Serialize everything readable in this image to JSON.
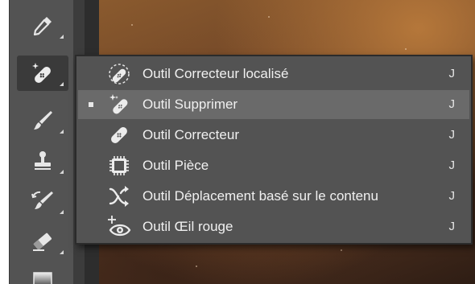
{
  "app": "Photoshop",
  "toolbar": {
    "tools": [
      {
        "name": "eyedropper-tool",
        "icon": "eyedropper-icon"
      },
      {
        "name": "spot-healing-tool",
        "icon": "healing-bandage-sparkle-icon",
        "active": true
      },
      {
        "name": "brush-tool",
        "icon": "brush-icon"
      },
      {
        "name": "clone-stamp-tool",
        "icon": "stamp-icon"
      },
      {
        "name": "history-brush-tool",
        "icon": "history-brush-icon"
      },
      {
        "name": "eraser-tool",
        "icon": "eraser-icon"
      },
      {
        "name": "gradient-tool",
        "icon": "gradient-icon"
      }
    ]
  },
  "flyout": {
    "items": [
      {
        "label": "Outil Correcteur localisé",
        "shortcut": "J",
        "icon": "spot-healing-brush-icon",
        "selected": false
      },
      {
        "label": "Outil Supprimer",
        "shortcut": "J",
        "icon": "remove-tool-icon",
        "selected": true
      },
      {
        "label": "Outil Correcteur",
        "shortcut": "J",
        "icon": "healing-brush-icon",
        "selected": false
      },
      {
        "label": "Outil Pièce",
        "shortcut": "J",
        "icon": "patch-icon",
        "selected": false
      },
      {
        "label": "Outil Déplacement basé sur le contenu",
        "shortcut": "J",
        "icon": "content-aware-move-icon",
        "selected": false
      },
      {
        "label": "Outil Œil rouge",
        "shortcut": "J",
        "icon": "red-eye-icon",
        "selected": false
      }
    ]
  },
  "colors": {
    "panel": "#535353",
    "selected_row": "#6a6a6a",
    "text": "#f0f0f0"
  }
}
